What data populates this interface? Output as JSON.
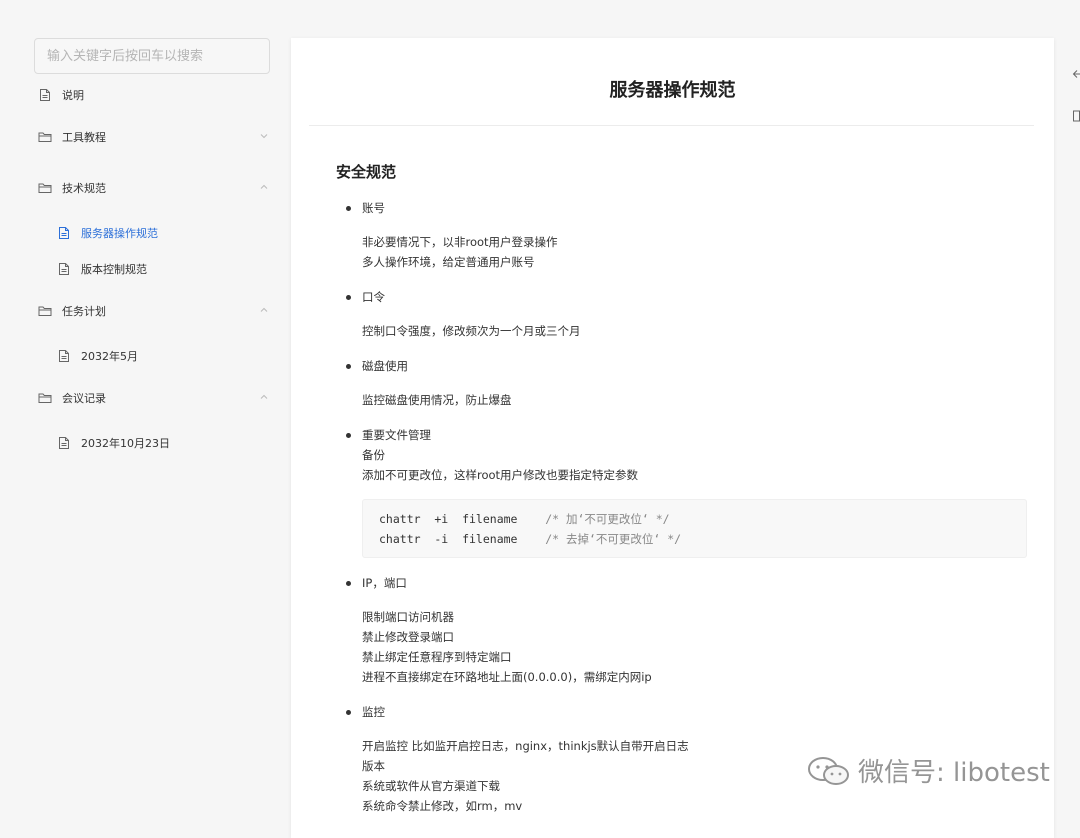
{
  "sidebar": {
    "search_placeholder": "输入关键字后按回车以搜索",
    "items": [
      {
        "label": "说明",
        "kind": "doc"
      },
      {
        "label": "工具教程",
        "kind": "folder",
        "expanded": false
      },
      {
        "label": "技术规范",
        "kind": "folder",
        "expanded": true
      },
      {
        "label": "服务器操作规范",
        "kind": "doc",
        "active": true
      },
      {
        "label": "版本控制规范",
        "kind": "doc"
      },
      {
        "label": "任务计划",
        "kind": "folder",
        "expanded": true
      },
      {
        "label": "2032年5月",
        "kind": "doc"
      },
      {
        "label": "会议记录",
        "kind": "folder",
        "expanded": true
      },
      {
        "label": "2032年10月23日",
        "kind": "doc"
      }
    ]
  },
  "article": {
    "title": "服务器操作规范",
    "section": "安全规范",
    "lines": [
      "账号",
      "非必要情况下，以非root用户登录操作",
      "多人操作环境，给定普通用户账号",
      "口令",
      "控制口令强度，修改频次为一个月或三个月",
      "磁盘使用",
      "监控磁盘使用情况，防止爆盘",
      "重要文件管理",
      "备份",
      "添加不可更改位，这样root用户修改也要指定特定参数",
      "IP，端口",
      "限制端口访问机器",
      "禁止修改登录端口",
      "禁止绑定任意程序到特定端口",
      "进程不直接绑定在环路地址上面(0.0.0.0)，需绑定内网ip",
      "监控",
      "开启监控 比如监开启控日志，nginx，thinkjs默认自带开启日志",
      "版本",
      "系统或软件从官方渠道下载",
      "系统命令禁止修改，如rm，mv"
    ],
    "code": [
      {
        "cmd": "chattr  +i  filename",
        "comment": "/* 加‘不可更改位‘ */"
      },
      {
        "cmd": "chattr  -i  filename",
        "comment": "/* 去掉‘不可更改位‘ */"
      }
    ]
  },
  "watermark": "微信号: libotest",
  "colors": {
    "accent": "#2c6fd8",
    "text": "#333333",
    "background": "#f6f6f6"
  }
}
